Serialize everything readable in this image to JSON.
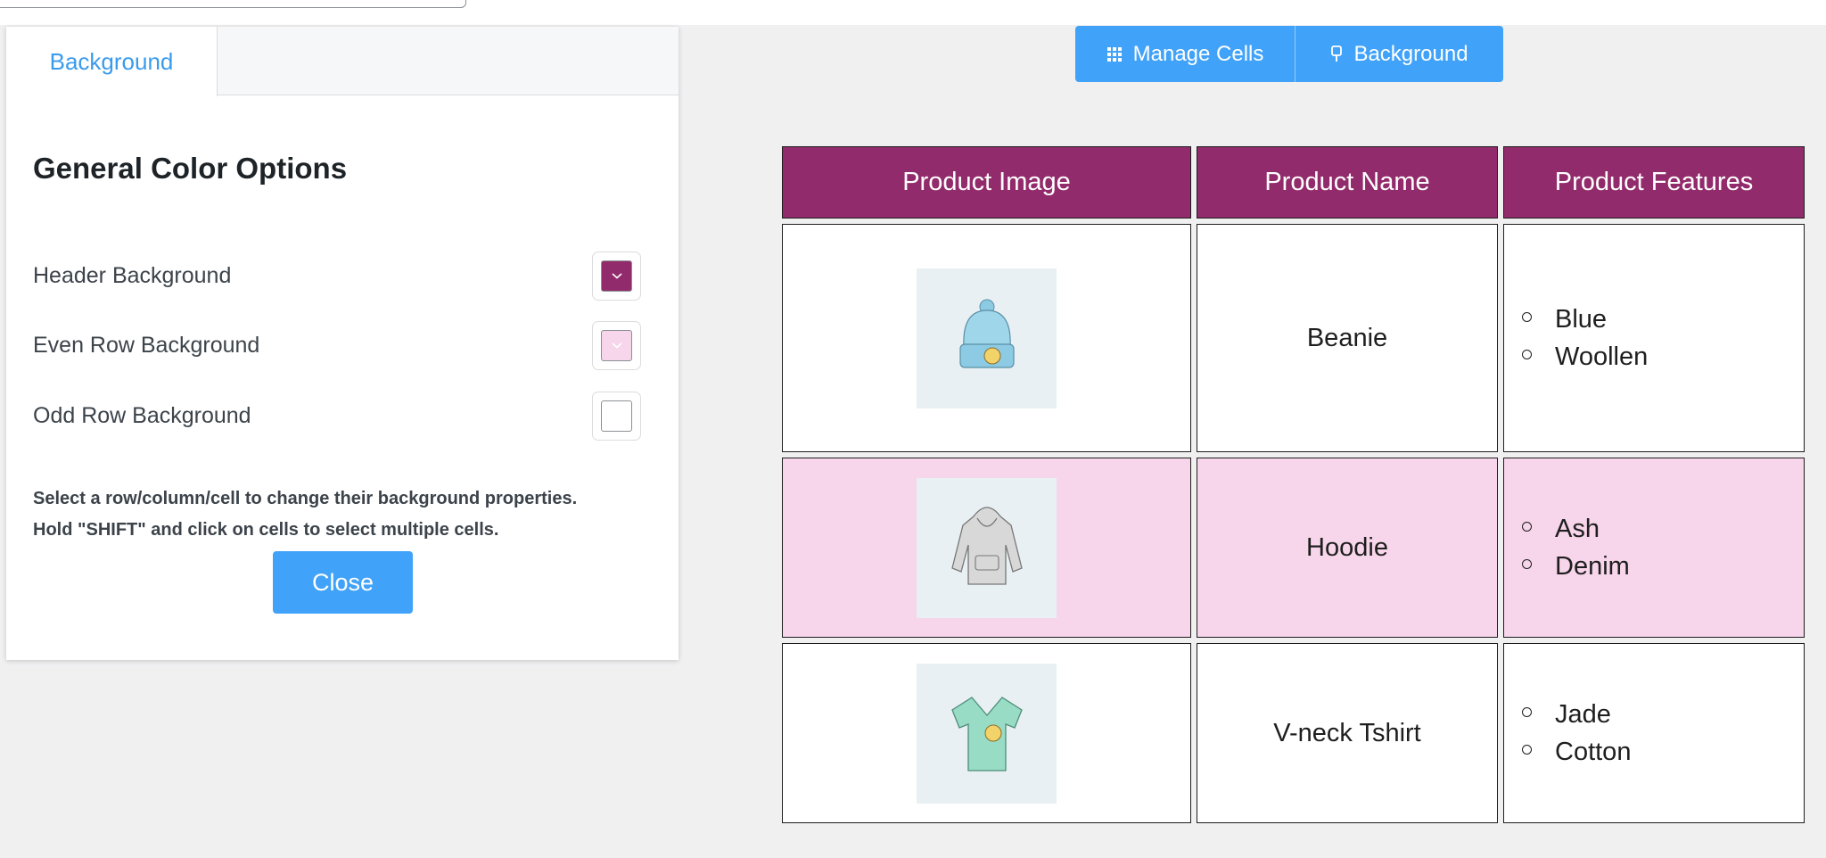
{
  "panel": {
    "tab": "Background",
    "section_title": "General Color Options",
    "options": [
      {
        "label": "Header Background",
        "color": "#922b6b"
      },
      {
        "label": "Even Row Background",
        "color": "#f7d5ea"
      },
      {
        "label": "Odd Row Background",
        "color": "#ffffff"
      }
    ],
    "help_line1": "Select a row/column/cell to change their background properties.",
    "help_line2": "Hold \"SHIFT\" and click on cells to select multiple cells.",
    "close_label": "Close"
  },
  "toolbar": {
    "manage_cells": "Manage Cells",
    "manage_cells_icon": "grid-icon",
    "background": "Background",
    "background_icon": "brush-icon"
  },
  "table": {
    "headers": [
      "Product Image",
      "Product Name",
      "Product Features"
    ],
    "rows": [
      {
        "image": "beanie-image",
        "name": "Beanie",
        "features": [
          "Blue",
          "Woollen"
        ]
      },
      {
        "image": "hoodie-image",
        "name": "Hoodie",
        "features": [
          "Ash",
          "Denim"
        ]
      },
      {
        "image": "tshirt-image",
        "name": "V-neck Tshirt",
        "features": [
          "Jade",
          "Cotton"
        ]
      }
    ]
  }
}
